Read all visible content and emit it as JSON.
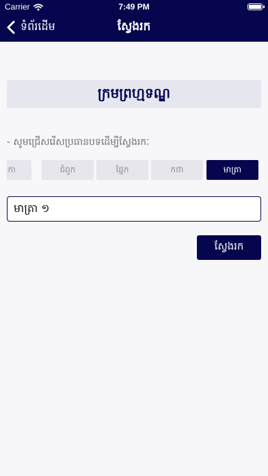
{
  "status_bar": {
    "carrier": "Carrier",
    "time": "7:49 PM"
  },
  "nav": {
    "back_label": "ទំព័រដើម",
    "title": "ស្វែងរក"
  },
  "banner": {
    "title": "ក្រមព្រហ្មទណ្ឌ"
  },
  "hint": "- សូមជ្រើសរើសប្រធានបទដើម្បីស្វែងរកៈ",
  "segments": [
    {
      "label": "ាតិកា",
      "active": false
    },
    {
      "label": "ជំពូក",
      "active": false
    },
    {
      "label": "ផ្នែក",
      "active": false
    },
    {
      "label": "កថា",
      "active": false
    },
    {
      "label": "មាត្រា",
      "active": true
    }
  ],
  "search_field": {
    "value": "មាត្រា ១"
  },
  "search_button": {
    "label": "ស្វែងរក"
  },
  "colors": {
    "primary": "#06064f",
    "segment_bg": "#e6e6ec",
    "page_bg": "#f7f7f9"
  }
}
